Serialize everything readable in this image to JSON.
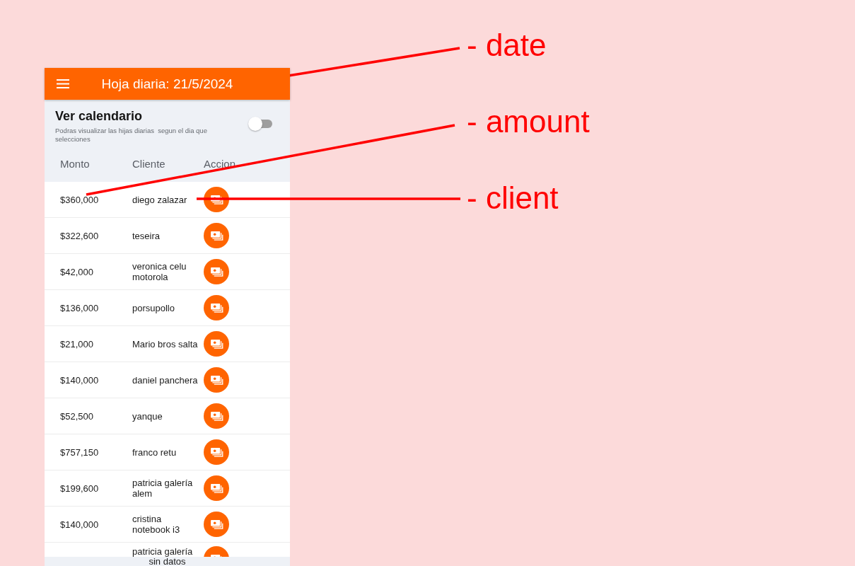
{
  "annotations": [
    {
      "label": "- date"
    },
    {
      "label": "- amount"
    },
    {
      "label": "- client"
    }
  ],
  "header": {
    "title": "Hoja diaria: 21/5/2024"
  },
  "calendar": {
    "title": "Ver calendario",
    "description": "Podras visualizar las hijas diarias  segun el dia que selecciones",
    "toggle": {
      "on": false
    }
  },
  "table": {
    "columns": [
      "Monto",
      "Cliente",
      "Accion"
    ],
    "rows": [
      {
        "amount": "$360,000",
        "client": "diego zalazar"
      },
      {
        "amount": "$322,600",
        "client": "teseira"
      },
      {
        "amount": "$42,000",
        "client": "veronica celu motorola"
      },
      {
        "amount": "$136,000",
        "client": "porsupollo"
      },
      {
        "amount": "$21,000",
        "client": "Mario bros salta"
      },
      {
        "amount": "$140,000",
        "client": "daniel panchera"
      },
      {
        "amount": "$52,500",
        "client": "yanque"
      },
      {
        "amount": "$757,150",
        "client": "franco retu"
      },
      {
        "amount": "$199,600",
        "client": "patricia galería alem"
      },
      {
        "amount": "$140,000",
        "client": "cristina notebook i3"
      },
      {
        "client": "patricia galería"
      }
    ]
  },
  "footer": {
    "message": "sin datos"
  }
}
